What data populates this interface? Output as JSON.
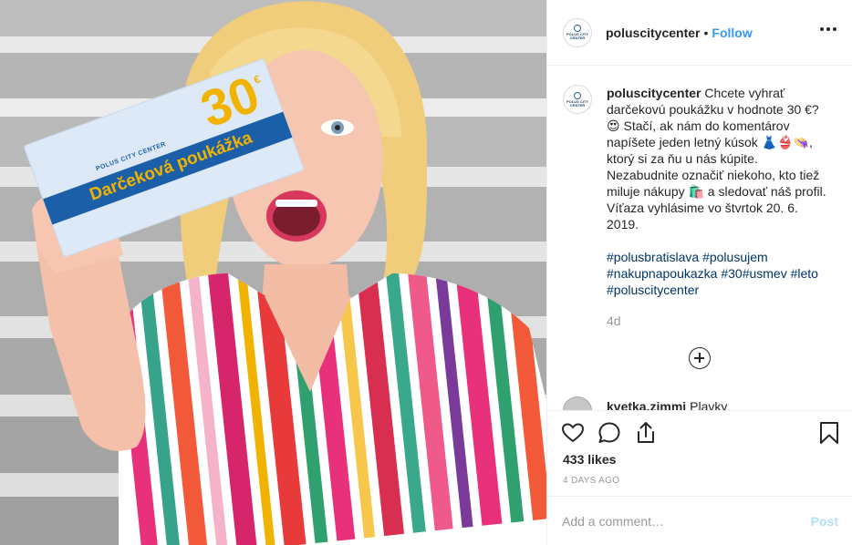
{
  "photo": {
    "voucher_title": "Darčeková poukážka",
    "voucher_value": "30",
    "voucher_currency": "€",
    "voucher_brand": "POLUS CITY CENTER"
  },
  "profile": {
    "username": "poluscitycenter",
    "follow_label": "Follow",
    "avatar_text": "POLUS CITY CENTER"
  },
  "caption": {
    "username": "poluscitycenter",
    "text": "Chcete vyhrať darčekovú poukážku v hodnote 30 €? 😍 Stačí, ak nám do komentárov napíšete jeden letný kúsok 👗👙👒, ktorý si za ňu u nás kúpite. Nezabudnite označiť niekoho, kto tiež miluje nákupy 🛍️ a sledovať náš profil. Víťaza vyhlásime vo štvrtok 20. 6. 2019.",
    "hashtags": [
      "#polusbratislava",
      "#polusujem",
      "#nakupnapoukazka",
      "#30",
      "#usmev",
      "#leto",
      "#poluscitycenter"
    ],
    "time": "4d"
  },
  "partial_comment": {
    "username": "kvetka.zimmi",
    "text": "Plavky"
  },
  "actions": {
    "icons": [
      "heart-icon",
      "comment-icon",
      "share-icon",
      "bookmark-icon"
    ],
    "likes": "433 likes",
    "date": "4 DAYS AGO"
  },
  "comment_box": {
    "placeholder": "Add a comment…",
    "post_label": "Post"
  },
  "colors": {
    "accent": "#3897f0",
    "hashtag": "#003569",
    "voucher_blue": "#1a5fa8",
    "voucher_yellow": "#f2b300"
  }
}
